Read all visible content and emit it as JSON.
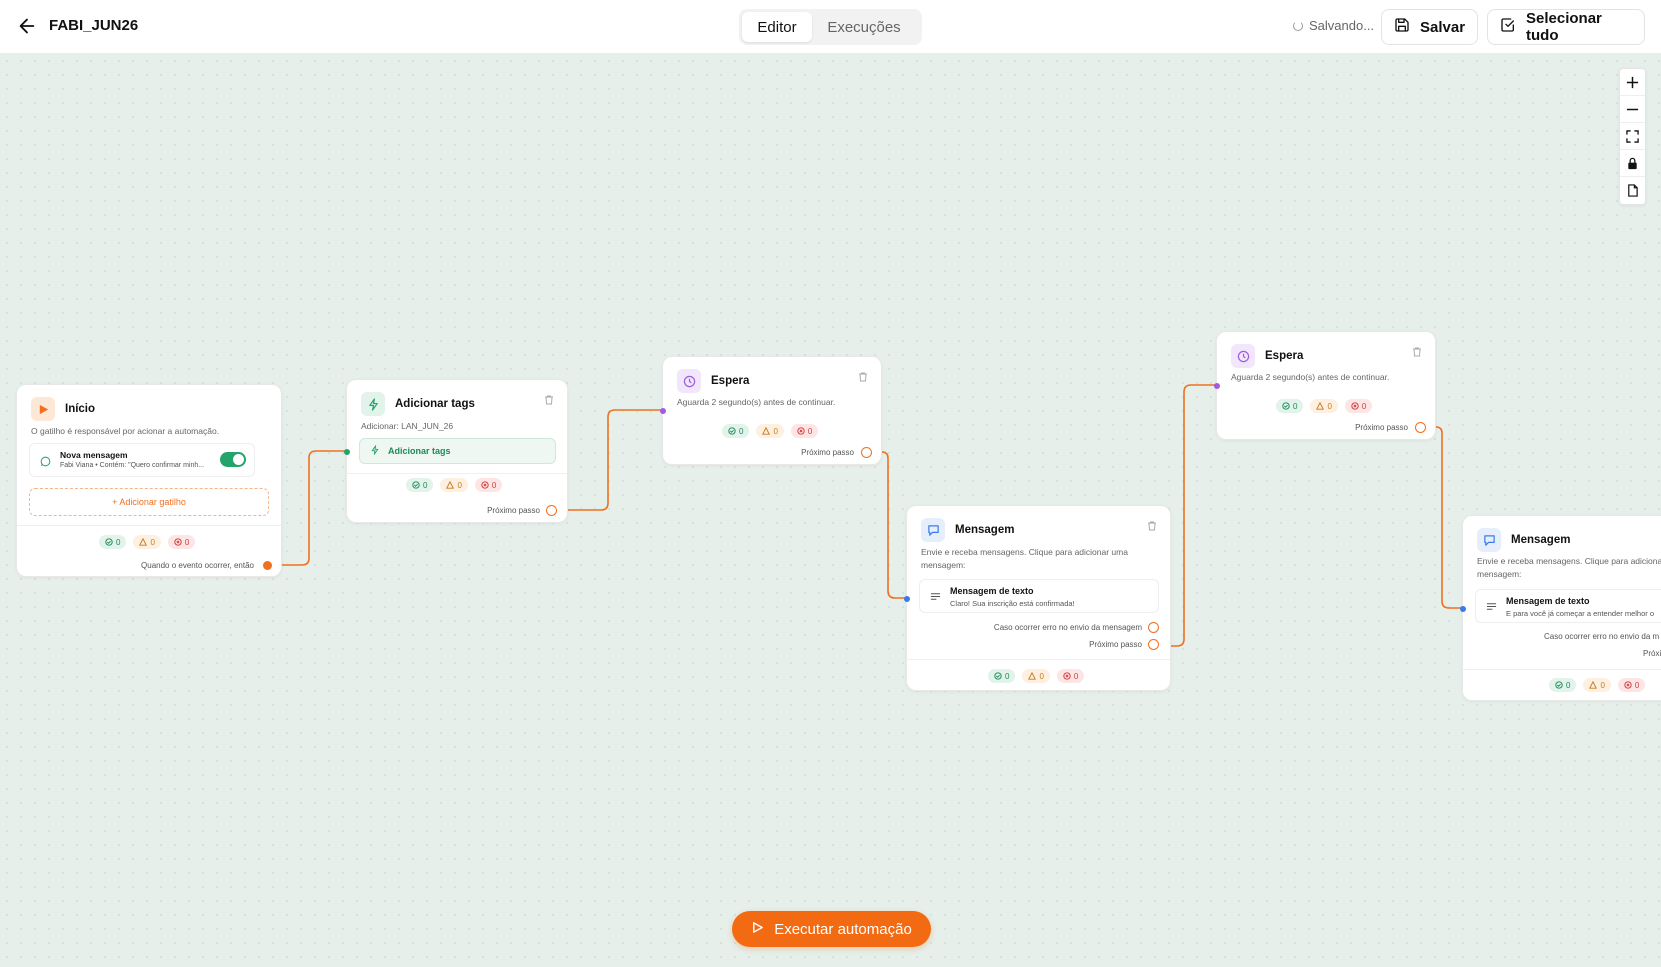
{
  "header": {
    "title": "FABI_JUN26",
    "tabs": [
      {
        "label": "Editor",
        "active": true
      },
      {
        "label": "Execuções",
        "active": false
      }
    ],
    "status": "Salvando...",
    "save_label": "Salvar",
    "select_all_label": "Selecionar tudo"
  },
  "colors": {
    "accent": "#f26a12",
    "canvas": "#e6efea",
    "success": "#22a46b",
    "purple": "#a05ce0",
    "blue": "#3b7be8"
  },
  "nodes": {
    "start": {
      "title": "Início",
      "desc": "O gatilho é responsável por acionar a automação.",
      "trigger_title": "Nova mensagem",
      "trigger_sub": "Fabi Viana • Contém: \"Quero confirmar minh...",
      "trigger_enabled": true,
      "add_trigger": "+ Adicionar gatilho",
      "stats": {
        "ok": "0",
        "warn": "0",
        "err": "0"
      },
      "next_label": "Quando o evento ocorrer, então"
    },
    "tags": {
      "title": "Adicionar tags",
      "desc": "Adicionar: LAN_JUN_26",
      "button": "Adicionar tags",
      "stats": {
        "ok": "0",
        "warn": "0",
        "err": "0"
      },
      "next_label": "Próximo passo"
    },
    "wait1": {
      "title": "Espera",
      "desc": "Aguarda 2 segundo(s) antes de continuar.",
      "stats": {
        "ok": "0",
        "warn": "0",
        "err": "0"
      },
      "next_label": "Próximo passo"
    },
    "msg1": {
      "title": "Mensagem",
      "desc1": "Envie e receba mensagens. Clique para adicionar uma",
      "desc2": "mensagem:",
      "item_title": "Mensagem de texto",
      "item_sub": "Claro! Sua inscrição está confirmada!",
      "error_label": "Caso ocorrer erro no envio da mensagem",
      "next_label": "Próximo passo",
      "stats": {
        "ok": "0",
        "warn": "0",
        "err": "0"
      }
    },
    "wait2": {
      "title": "Espera",
      "desc": "Aguarda 2 segundo(s) antes de continuar.",
      "stats": {
        "ok": "0",
        "warn": "0",
        "err": "0"
      },
      "next_label": "Próximo passo"
    },
    "msg2": {
      "title": "Mensagem",
      "desc1": "Envie e receba mensagens. Clique para adiciona",
      "desc2": "mensagem:",
      "item_title": "Mensagem de texto",
      "item_sub": "E para você já começar a entender melhor o",
      "error_label": "Caso ocorrer erro no envio da m",
      "next_label": "Próxi",
      "stats": {
        "ok": "0",
        "warn": "0",
        "err": "0"
      }
    }
  },
  "run_label": "Executar automação"
}
